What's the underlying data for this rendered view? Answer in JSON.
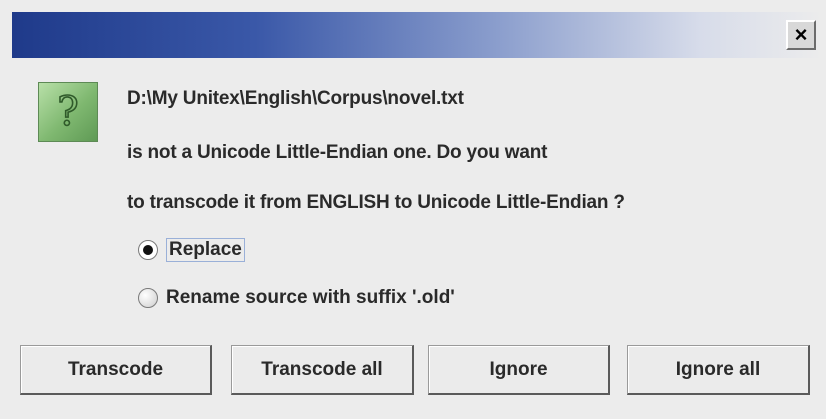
{
  "window": {
    "close_symbol": "×"
  },
  "icon": {
    "name": "question-icon",
    "glyph": "?"
  },
  "message": {
    "line1": "D:\\My Unitex\\English\\Corpus\\novel.txt",
    "line2": "is not a Unicode Little-Endian one. Do you want",
    "line3": "to transcode it from ENGLISH to Unicode Little-Endian ?"
  },
  "options": [
    {
      "label": "Replace",
      "selected": true
    },
    {
      "label": "Rename source with suffix '.old'",
      "selected": false
    }
  ],
  "buttons": {
    "transcode": "Transcode",
    "transcode_all": "Transcode all",
    "ignore": "Ignore",
    "ignore_all": "Ignore all"
  },
  "colors": {
    "titlebar_start": "#1f3a8a",
    "dialog_background": "#ececec",
    "icon_green": "#7fb870"
  }
}
